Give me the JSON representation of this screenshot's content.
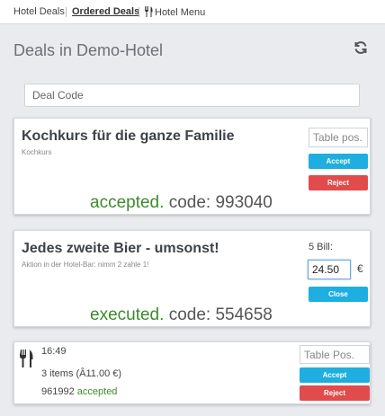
{
  "nav": {
    "hotel_deals": "Hotel Deals",
    "ordered_deals": "Ordered Deals",
    "hotel_menu": "Hotel Menu"
  },
  "page": {
    "title": "Deals in Demo-Hotel",
    "deal_code_placeholder": "Deal Code"
  },
  "deals": [
    {
      "title": "Kochkurs für die ganze Familie",
      "subtitle": "Kochkurs",
      "table_pos_placeholder": "Table pos.",
      "accept_label": "Accept",
      "reject_label": "Reject",
      "status": "accepted.",
      "code_text": "code: 993040"
    },
    {
      "title": "Jedes zweite Bier - umsonst!",
      "subtitle": "Aktion in der Hotel-Bar: nimm 2 zahle 1!",
      "bill_label": "5 Bill:",
      "bill_value": "24.50",
      "currency": "€",
      "close_label": "Close",
      "status": "executed.",
      "code_text": "code: 554658"
    }
  ],
  "order": {
    "time": "16:49",
    "items_text": "3 items (Â11.00 €)",
    "code": "961992",
    "status": "accepted",
    "table_pos_placeholder": "Table Pos.",
    "accept_label": "Accept",
    "reject_label": "Reject"
  },
  "colors": {
    "accent": "#1eaee0",
    "danger": "#e24b4b",
    "success": "#3d8a2e"
  },
  "icons": [
    "fork-knife-icon",
    "refresh-icon"
  ]
}
